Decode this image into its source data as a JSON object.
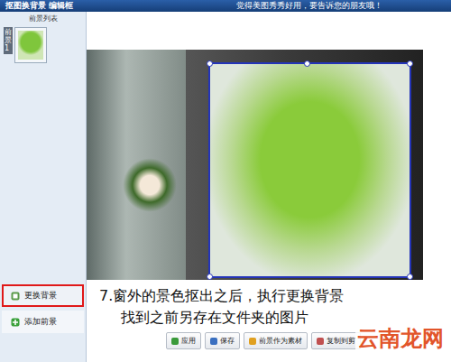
{
  "window": {
    "title": "抠图换背景 编辑框",
    "slogan": "觉得美图秀秀好用，要告诉您的朋友哦！"
  },
  "foreground_list": {
    "title": "前景列表",
    "items": [
      {
        "label": "前景1",
        "selected": true
      }
    ]
  },
  "sidebar_buttons": [
    {
      "label": "更换背景",
      "highlighted": true
    },
    {
      "label": "添加前景",
      "highlighted": false
    }
  ],
  "annotation": [
    "7.窗外的景色抠出之后，执行更换背景",
    "找到之前另存在文件夹的图片"
  ],
  "watermark": "云南龙网",
  "buttons": [
    {
      "label": "应用"
    },
    {
      "label": "保存"
    },
    {
      "label": "前景作为素材"
    },
    {
      "label": "复制到剪"
    }
  ]
}
